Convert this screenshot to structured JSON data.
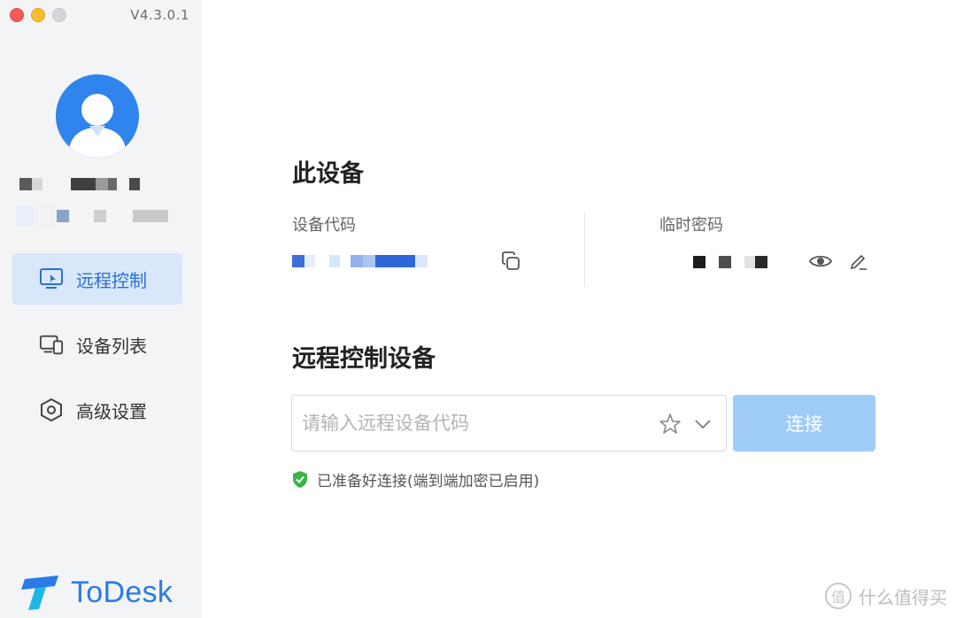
{
  "app": {
    "version": "V4.3.0.1"
  },
  "sidebar": {
    "nav": [
      {
        "label": "远程控制",
        "icon": "remote-control-icon",
        "active": true
      },
      {
        "label": "设备列表",
        "icon": "device-list-icon",
        "active": false
      },
      {
        "label": "高级设置",
        "icon": "settings-hex-icon",
        "active": false
      }
    ],
    "brand": "ToDesk"
  },
  "device": {
    "title": "此设备",
    "code_label": "设备代码",
    "password_label": "临时密码"
  },
  "remote": {
    "title": "远程控制设备",
    "placeholder": "请输入远程设备代码",
    "connect_label": "连接",
    "status": "已准备好连接(端到端加密已启用)"
  },
  "watermark": {
    "text": "什么值得买",
    "icon_char": "值"
  },
  "colors": {
    "accent": "#2a7be8",
    "connect": "#9fcbf8",
    "secure": "#3bb54a"
  }
}
